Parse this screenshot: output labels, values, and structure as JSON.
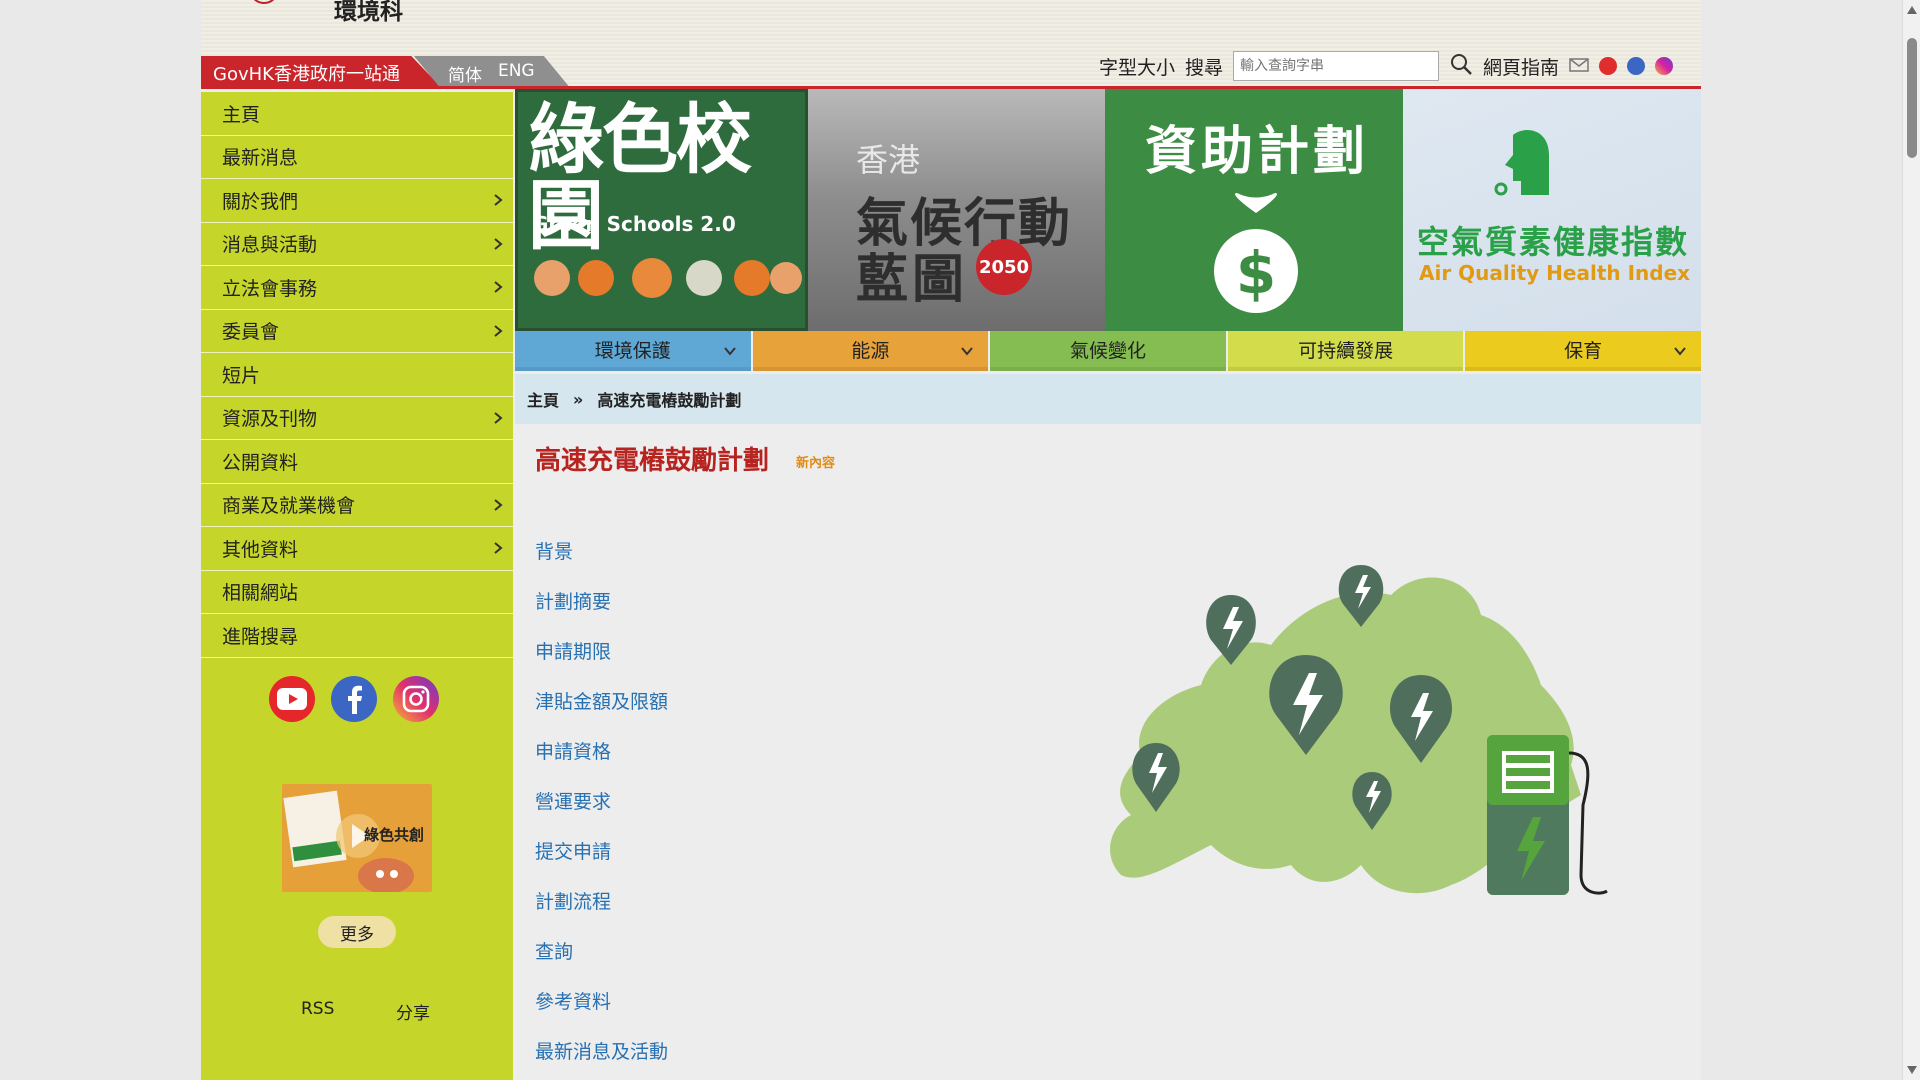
{
  "header": {
    "dept_name": "環境科",
    "govhk_label": "GovHK香港政府一站通",
    "lang_simplified": "简体",
    "lang_english": "ENG",
    "font_size_label": "字型大小",
    "search_label": "搜尋",
    "search_placeholder": "輸入查詢字串",
    "site_guide_label": "網頁指南"
  },
  "sidebar": {
    "items": [
      {
        "label": "主頁",
        "has_submenu": false
      },
      {
        "label": "最新消息",
        "has_submenu": false
      },
      {
        "label": "關於我們",
        "has_submenu": true
      },
      {
        "label": "消息與活動",
        "has_submenu": true
      },
      {
        "label": "立法會事務",
        "has_submenu": true
      },
      {
        "label": "委員會",
        "has_submenu": true
      },
      {
        "label": "短片",
        "has_submenu": false
      },
      {
        "label": "資源及刊物",
        "has_submenu": true
      },
      {
        "label": "公開資料",
        "has_submenu": false
      },
      {
        "label": "商業及就業機會",
        "has_submenu": true
      },
      {
        "label": "其他資料",
        "has_submenu": true
      },
      {
        "label": "相關網站",
        "has_submenu": false
      },
      {
        "label": "進階搜尋",
        "has_submenu": false
      }
    ],
    "promo_text": "綠色共創",
    "more_label": "更多",
    "rss_label": "RSS",
    "share_label": "分享"
  },
  "banners": {
    "b1_title": "綠色校園",
    "b1_subtitle": "Green Schools 2.0",
    "b2_line1": "香港",
    "b2_line2": "氣候行動",
    "b2_line3": "藍圖",
    "b2_badge": "2050",
    "b3_title": "資助計劃",
    "b4_title": "空氣質素健康指數",
    "b4_subtitle": "Air Quality Health Index"
  },
  "topics": [
    {
      "label": "環境保護",
      "color": "#5fa8d6",
      "has_dropdown": true
    },
    {
      "label": "能源",
      "color": "#e8a23a",
      "has_dropdown": true
    },
    {
      "label": "氣候變化",
      "color": "#86bd53",
      "has_dropdown": false
    },
    {
      "label": "可持續發展",
      "color": "#d3dc4a",
      "has_dropdown": false
    },
    {
      "label": "保育",
      "color": "#eccb1f",
      "has_dropdown": true
    }
  ],
  "breadcrumb": {
    "home": "主頁",
    "separator": "»",
    "current": "高速充電樁鼓勵計劃"
  },
  "content": {
    "title": "高速充電樁鼓勵計劃",
    "new_tag": "新內容",
    "links": [
      "背景",
      "計劃摘要",
      "申請期限",
      "津貼金額及限額",
      "申請資格",
      "營運要求",
      "提交申請",
      "計劃流程",
      "查詢",
      "參考資料",
      "最新消息及活動"
    ]
  },
  "colors": {
    "accent_red": "#c9252b",
    "sidebar_green": "#c5d52a",
    "link_blue": "#2771b3",
    "title_red": "#b7231e"
  }
}
